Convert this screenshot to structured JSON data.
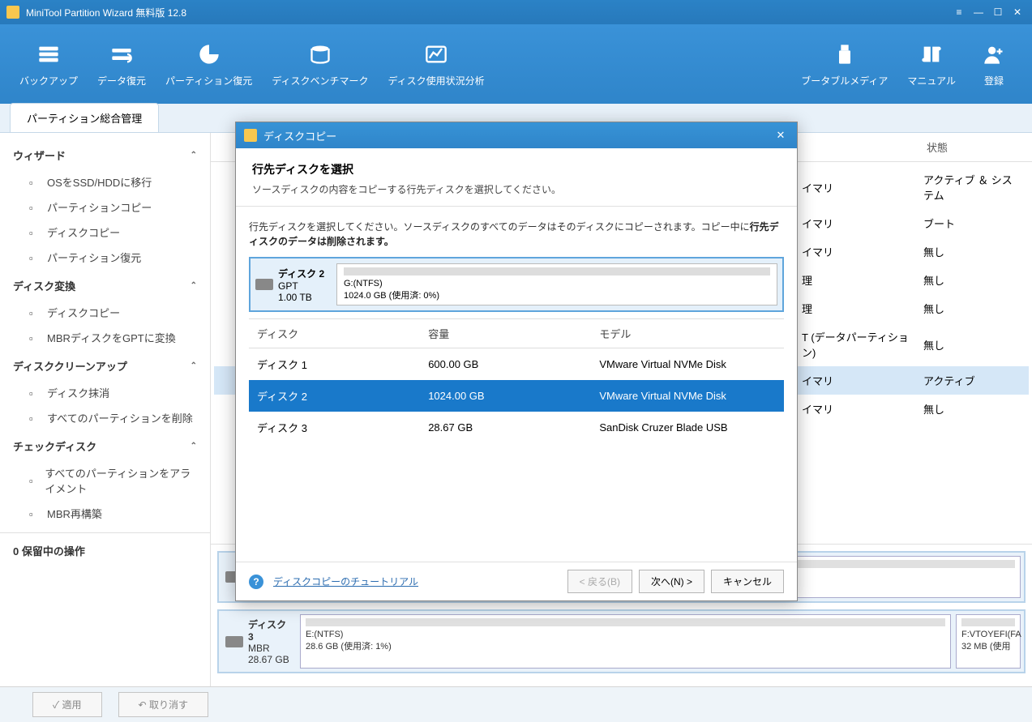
{
  "titlebar": {
    "title": "MiniTool Partition Wizard 無料版  12.8"
  },
  "toolbar": {
    "left": [
      {
        "key": "backup",
        "label": "バックアップ"
      },
      {
        "key": "data-recovery",
        "label": "データ復元"
      },
      {
        "key": "partition-recovery",
        "label": "パーティション復元"
      },
      {
        "key": "disk-benchmark",
        "label": "ディスクベンチマーク"
      },
      {
        "key": "disk-usage",
        "label": "ディスク使用状況分析"
      }
    ],
    "right": [
      {
        "key": "bootable-media",
        "label": "ブータブルメディア"
      },
      {
        "key": "manual",
        "label": "マニュアル"
      },
      {
        "key": "register",
        "label": "登録"
      }
    ]
  },
  "tabs": {
    "active": "パーティション総合管理"
  },
  "sidebar": {
    "groups": [
      {
        "title": "ウィザード",
        "items": [
          "OSをSSD/HDDに移行",
          "パーティションコピー",
          "ディスクコピー",
          "パーティション復元"
        ]
      },
      {
        "title": "ディスク変換",
        "items": [
          "ディスクコピー",
          "MBRディスクをGPTに変換"
        ]
      },
      {
        "title": "ディスククリーンアップ",
        "items": [
          "ディスク抹消",
          "すべてのパーティションを削除"
        ]
      },
      {
        "title": "チェックディスク",
        "items": [
          "すべてのパーティションをアライメント",
          "MBR再構築"
        ]
      }
    ],
    "pending": "0 保留中の操作"
  },
  "list": {
    "headers": {
      "status_col": "状態"
    },
    "rows": [
      {
        "type": "イマリ",
        "status": "アクティブ ＆ システム"
      },
      {
        "type": "イマリ",
        "status": "ブート"
      },
      {
        "type": "イマリ",
        "status": "無し"
      },
      {
        "type": "理",
        "status": "無し"
      },
      {
        "type": "理",
        "status": "無し"
      },
      {
        "type": "T (データパーティション)",
        "status": "無し"
      },
      {
        "type": "イマリ",
        "status": "アクティブ"
      },
      {
        "type": "イマリ",
        "status": "無し"
      }
    ]
  },
  "diskmap": {
    "disk2": {
      "name_line": "GPT",
      "size": "1.00 TB",
      "part_label": "G:(NTFS)",
      "part_size": "1024.0 GB (使用済: 0%)"
    },
    "disk3": {
      "name": "ディスク 3",
      "type": "MBR",
      "size": "28.67 GB",
      "p1_label": "E:(NTFS)",
      "p1_size": "28.6 GB (使用済: 1%)",
      "p2_label": "F:VTOYEFI(FA",
      "p2_size": "32 MB (使用"
    }
  },
  "footer": {
    "apply": "適用",
    "undo": "取り消す"
  },
  "modal": {
    "title": "ディスクコピー",
    "heading": "行先ディスクを選択",
    "subheading": "ソースディスクの内容をコピーする行先ディスクを選択してください。",
    "note_a": "行先ディスクを選択してください。ソースディスクのすべてのデータはそのディスクにコピーされます。コピー中に",
    "note_b": "行先ディスクのデータは削除されます。",
    "preview": {
      "name": "ディスク 2",
      "type": "GPT",
      "size": "1.00 TB",
      "part_label": "G:(NTFS)",
      "part_size": "1024.0 GB (使用済: 0%)"
    },
    "table": {
      "cols": {
        "disk": "ディスク",
        "capacity": "容量",
        "model": "モデル"
      },
      "rows": [
        {
          "disk": "ディスク 1",
          "capacity": "600.00 GB",
          "model": "VMware Virtual NVMe Disk",
          "selected": false
        },
        {
          "disk": "ディスク 2",
          "capacity": "1024.00 GB",
          "model": "VMware Virtual NVMe Disk",
          "selected": true
        },
        {
          "disk": "ディスク 3",
          "capacity": "28.67 GB",
          "model": "SanDisk Cruzer Blade USB",
          "selected": false
        }
      ]
    },
    "help": "ディスクコピーのチュートリアル",
    "buttons": {
      "back": "< 戻る(B)",
      "next": "次へ(N) >",
      "cancel": "キャンセル"
    }
  }
}
